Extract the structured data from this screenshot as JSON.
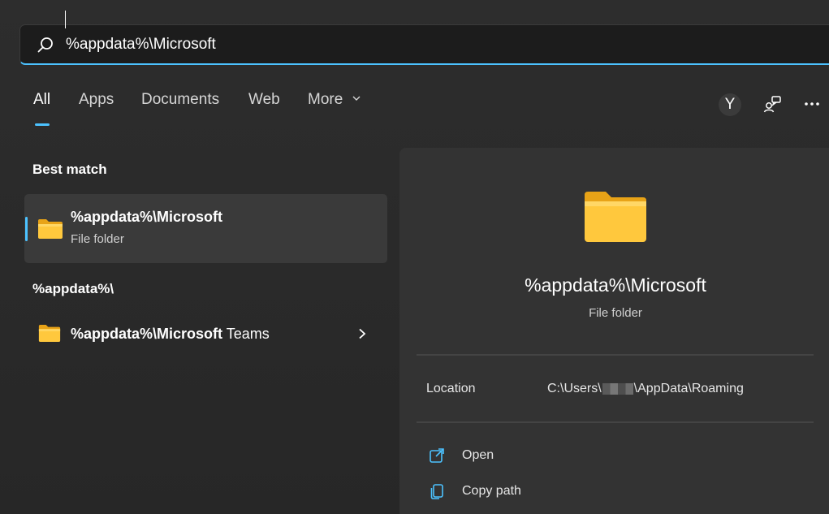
{
  "search": {
    "value": "%appdata%\\Microsoft",
    "placeholder": ""
  },
  "tabs": [
    {
      "label": "All",
      "active": true
    },
    {
      "label": "Apps"
    },
    {
      "label": "Documents"
    },
    {
      "label": "Web"
    },
    {
      "label": "More"
    }
  ],
  "header_actions": {
    "avatar_initial": "Y",
    "feedback_icon": "feedback-icon",
    "more_icon": "ellipsis-icon"
  },
  "best_match": {
    "heading": "Best match",
    "item": {
      "title": "%appdata%\\Microsoft",
      "subtitle": "File folder",
      "icon": "folder-icon"
    }
  },
  "group": {
    "heading": "%appdata%\\",
    "items": [
      {
        "title_bold": "%appdata%\\Microsoft",
        "title_rest": " Teams",
        "icon": "folder-icon"
      }
    ]
  },
  "preview": {
    "title": "%appdata%\\Microsoft",
    "subtitle": "File folder",
    "location_label": "Location",
    "location_prefix": "C:\\Users\\",
    "location_suffix": "\\AppData\\Roaming",
    "actions": [
      {
        "label": "Open",
        "icon": "open-external-icon"
      },
      {
        "label": "Copy path",
        "icon": "copy-icon"
      }
    ]
  },
  "colors": {
    "accent": "#4cc2ff",
    "folder": "#ffc83d"
  }
}
